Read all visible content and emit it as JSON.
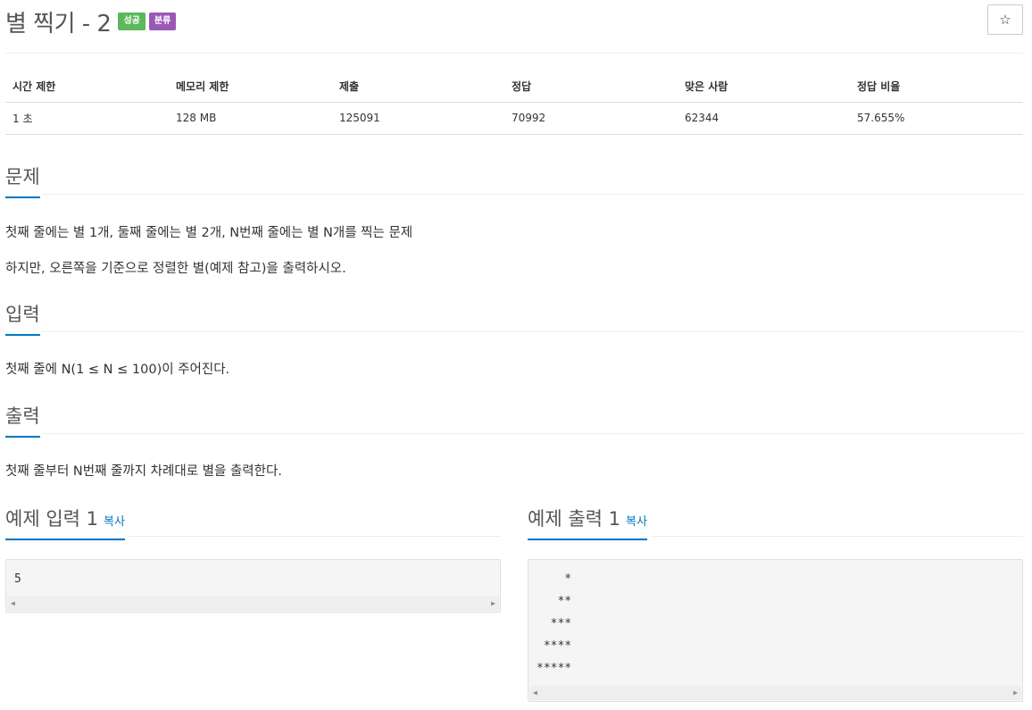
{
  "problem": {
    "title": "별 찍기 - 2",
    "badges": {
      "success": "성공",
      "category": "분류"
    },
    "star_icon": "☆"
  },
  "info_table": {
    "headers": [
      "시간 제한",
      "메모리 제한",
      "제출",
      "정답",
      "맞은 사람",
      "정답 비율"
    ],
    "values": [
      "1 초",
      "128 MB",
      "125091",
      "70992",
      "62344",
      "57.655%"
    ]
  },
  "sections": {
    "description": {
      "heading": "문제",
      "paragraphs": [
        "첫째 줄에는 별 1개, 둘째 줄에는 별 2개, N번째 줄에는 별 N개를 찍는 문제",
        "하지만, 오른쪽을 기준으로 정렬한 별(예제 참고)을 출력하시오."
      ]
    },
    "input": {
      "heading": "입력",
      "text": "첫째 줄에 N(1 ≤ N ≤ 100)이 주어진다."
    },
    "output": {
      "heading": "출력",
      "text": "첫째 줄부터 N번째 줄까지 차례대로 별을 출력한다."
    }
  },
  "samples": {
    "input": {
      "heading": "예제 입력 1",
      "copy": "복사",
      "lines": [
        "5"
      ]
    },
    "output": {
      "heading": "예제 출력 1",
      "copy": "복사",
      "lines": [
        "    *",
        "   **",
        "  ***",
        " ****",
        "*****"
      ]
    }
  },
  "colors": {
    "accent": "#0076c0",
    "success": "#5cb85c",
    "category": "#9b59b6"
  }
}
